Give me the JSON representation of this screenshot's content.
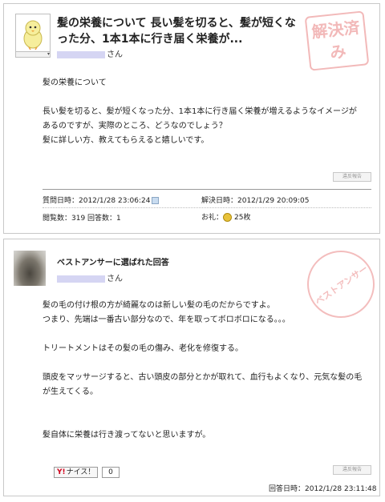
{
  "question": {
    "title": "髪の栄養について 長い髪を切ると、髪が短くなった分、1本1本に行き届く栄養が...",
    "user_suffix": "さん",
    "stamp_text": "解決済み",
    "body": "髪の栄養について\n\n長い髪を切ると、髪が短くなった分、1本1本に行き届く栄養が増えるようなイメージがあるのですが、実際のところ、どうなのでしょう？\n髪に詳しい方、教えてもらえると嬉しいです。",
    "report_label": "違反報告",
    "asked_label": "質問日時：2012/1/28 23:06:24",
    "resolved_label": "解決日時：2012/1/29 20:09:05",
    "views_label": "閲覧数：319",
    "answers_label": "回答数：1",
    "reward_label": "お礼：",
    "reward_value": "25枚"
  },
  "best_answer": {
    "heading": "ベストアンサーに選ばれた回答",
    "user_suffix": "さん",
    "stamp_text": "ベストアンサー",
    "body": "髪の毛の付け根の方が綺麗なのは新しい髪の毛のだからですよ。\nつまり、先端は一番古い部分なので、年を取ってボロボロになる。。。\n\nトリートメントはその髪の毛の傷み、老化を修復する。\n\n頭皮をマッサージすると、古い頭皮の部分とかが取れて、血行もよくなり、元気な髪の毛が生えてくる。\n\n\n髪自体に栄養は行き渡ってないと思いますが。",
    "nice_label": "ナイス！",
    "nice_y": "Y!",
    "nice_count": "0",
    "report_label": "違反報告",
    "answered_label": "回答日時：2012/1/28 23:11:48"
  }
}
